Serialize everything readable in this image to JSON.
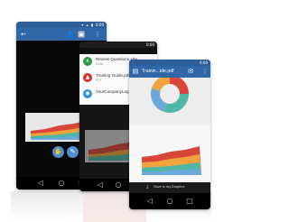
{
  "phone_left": {
    "status_time": "0:00",
    "status_icons": "▾ ▴ ▮",
    "toolbar": {
      "back_icon": "←",
      "person_icon": "👤",
      "pdf_icon": "▣",
      "more_icon": "⋮"
    },
    "fabs": {
      "hand_icon": "✋",
      "pen_icon": "✎"
    },
    "nav": {
      "back": "◁",
      "home": "○",
      "recents": "□"
    }
  },
  "phone_middle": {
    "status_time": "0:00",
    "files": [
      {
        "name": "Review Questions.xlsx",
        "sub": "Excel",
        "icon": "x",
        "color": "#2e9a45"
      },
      {
        "name": "Training Guide.pdf",
        "sub": "PDF",
        "icon": "▲",
        "color": "#d7322c"
      },
      {
        "name": "YourCompanyLogo...",
        "sub": "",
        "icon": "◉",
        "color": "#2b95d4"
      }
    ],
    "download_icon": "⤓",
    "nav": {
      "back": "◁",
      "home": "○",
      "recents": "□"
    }
  },
  "phone_right": {
    "status_time": "0:00",
    "title": "Trainin...ide.pdf",
    "toolbar": {
      "doc_icon": "▤",
      "mail_icon": "✉",
      "more_icon": "⋮"
    },
    "save_label": "Save to my Dropbox",
    "save_icon": "⤓",
    "nav": {
      "back": "◁",
      "home": "○",
      "recents": "□"
    }
  },
  "colors": {
    "toolbar_blue": "#2f67a8",
    "area_red": "#d8463a",
    "area_orange": "#f0a33a",
    "area_teal": "#4fb7a6",
    "area_blue": "#6aa9d9"
  }
}
